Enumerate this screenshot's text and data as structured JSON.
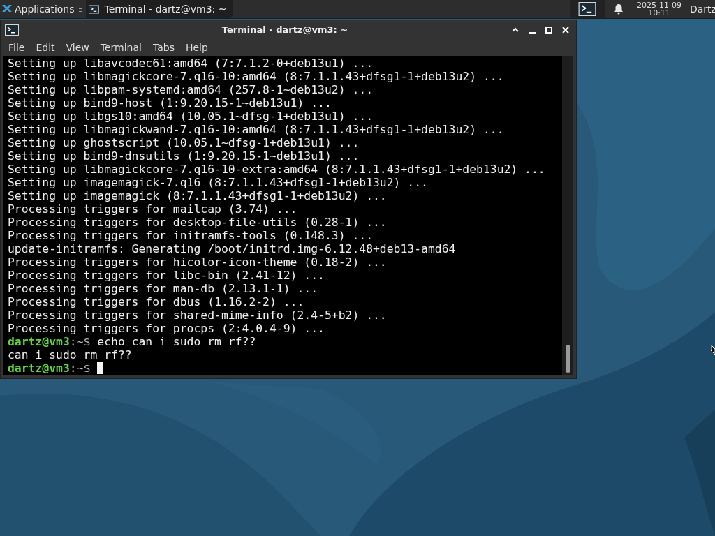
{
  "panel": {
    "applications_label": "Applications",
    "tasks": [
      {
        "title": "Terminal - dartz@vm3: ~",
        "selected": true
      }
    ],
    "clock": {
      "date": "2025-11-09",
      "time": "10:11"
    },
    "user": "Dartz"
  },
  "window": {
    "title": "Terminal - dartz@vm3: ~",
    "menu": [
      "File",
      "Edit",
      "View",
      "Terminal",
      "Tabs",
      "Help"
    ]
  },
  "terminal": {
    "lines": [
      {
        "kind": "output",
        "text": "Setting up libavcodec61:amd64 (7:7.1.2-0+deb13u1) ..."
      },
      {
        "kind": "output",
        "text": "Setting up libmagickcore-7.q16-10:amd64 (8:7.1.1.43+dfsg1-1+deb13u2) ..."
      },
      {
        "kind": "output",
        "text": "Setting up libpam-systemd:amd64 (257.8-1~deb13u2) ..."
      },
      {
        "kind": "output",
        "text": "Setting up bind9-host (1:9.20.15-1~deb13u1) ..."
      },
      {
        "kind": "output",
        "text": "Setting up libgs10:amd64 (10.05.1~dfsg-1+deb13u1) ..."
      },
      {
        "kind": "output",
        "text": "Setting up libmagickwand-7.q16-10:amd64 (8:7.1.1.43+dfsg1-1+deb13u2) ..."
      },
      {
        "kind": "output",
        "text": "Setting up ghostscript (10.05.1~dfsg-1+deb13u1) ..."
      },
      {
        "kind": "output",
        "text": "Setting up bind9-dnsutils (1:9.20.15-1~deb13u1) ..."
      },
      {
        "kind": "output",
        "text": "Setting up libmagickcore-7.q16-10-extra:amd64 (8:7.1.1.43+dfsg1-1+deb13u2) ..."
      },
      {
        "kind": "output",
        "text": "Setting up imagemagick-7.q16 (8:7.1.1.43+dfsg1-1+deb13u2) ..."
      },
      {
        "kind": "output",
        "text": "Setting up imagemagick (8:7.1.1.43+dfsg1-1+deb13u2) ..."
      },
      {
        "kind": "output",
        "text": "Processing triggers for mailcap (3.74) ..."
      },
      {
        "kind": "output",
        "text": "Processing triggers for desktop-file-utils (0.28-1) ..."
      },
      {
        "kind": "output",
        "text": "Processing triggers for initramfs-tools (0.148.3) ..."
      },
      {
        "kind": "output",
        "text": "update-initramfs: Generating /boot/initrd.img-6.12.48+deb13-amd64"
      },
      {
        "kind": "output",
        "text": "Processing triggers for hicolor-icon-theme (0.18-2) ..."
      },
      {
        "kind": "output",
        "text": "Processing triggers for libc-bin (2.41-12) ..."
      },
      {
        "kind": "output",
        "text": "Processing triggers for man-db (2.13.1-1) ..."
      },
      {
        "kind": "output",
        "text": "Processing triggers for dbus (1.16.2-2) ..."
      },
      {
        "kind": "output",
        "text": "Processing triggers for shared-mime-info (2.4-5+b2) ..."
      },
      {
        "kind": "output",
        "text": "Processing triggers for procps (2:4.0.4-9) ..."
      },
      {
        "kind": "prompt",
        "user": "dartz@vm3",
        "path": ":~$",
        "command": "echo can i sudo rm rf??"
      },
      {
        "kind": "output",
        "text": "can i sudo rm rf??"
      },
      {
        "kind": "prompt",
        "user": "dartz@vm3",
        "path": ":~$",
        "cursor": true
      }
    ]
  }
}
